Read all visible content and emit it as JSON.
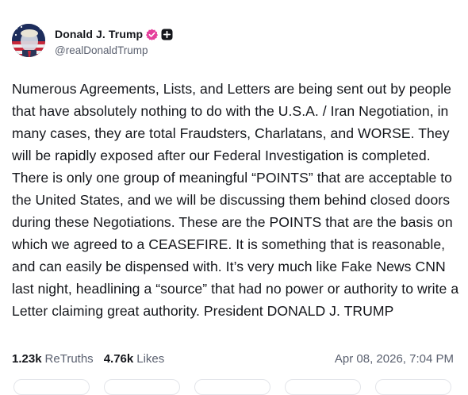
{
  "author": {
    "display_name": "Donald J. Trump",
    "handle": "@realDonaldTrump",
    "verified_badge_color": "#e5409c",
    "follow_icon": "plus-square-icon"
  },
  "post": {
    "text": "Numerous Agreements, Lists, and Letters are being sent out by people that have absolutely nothing to do with the U.S.A. / Iran Negotiation, in many cases, they are total Fraudsters, Charlatans, and WORSE. They will be rapidly exposed after our Federal Investigation is completed. There is only one group of meaningful “POINTS” that are acceptable to the United States, and we will be discussing them behind closed doors during these Negotiations. These are the POINTS that are the basis on which we agreed to a CEASEFIRE. It is something that is reasonable, and can easily be dispensed with. It’s very much like Fake News CNN last night, headlining a “source” that had no power or authority to write a Letter claiming great authority. President DONALD J. TRUMP"
  },
  "stats": {
    "retruths_count": "1.23k",
    "retruths_label": "ReTruths",
    "likes_count": "4.76k",
    "likes_label": "Likes"
  },
  "timestamp": "Apr 08, 2026, 7:04 PM",
  "actions": [
    "reply-button",
    "retruth-button",
    "like-button",
    "share-button",
    "more-button"
  ]
}
